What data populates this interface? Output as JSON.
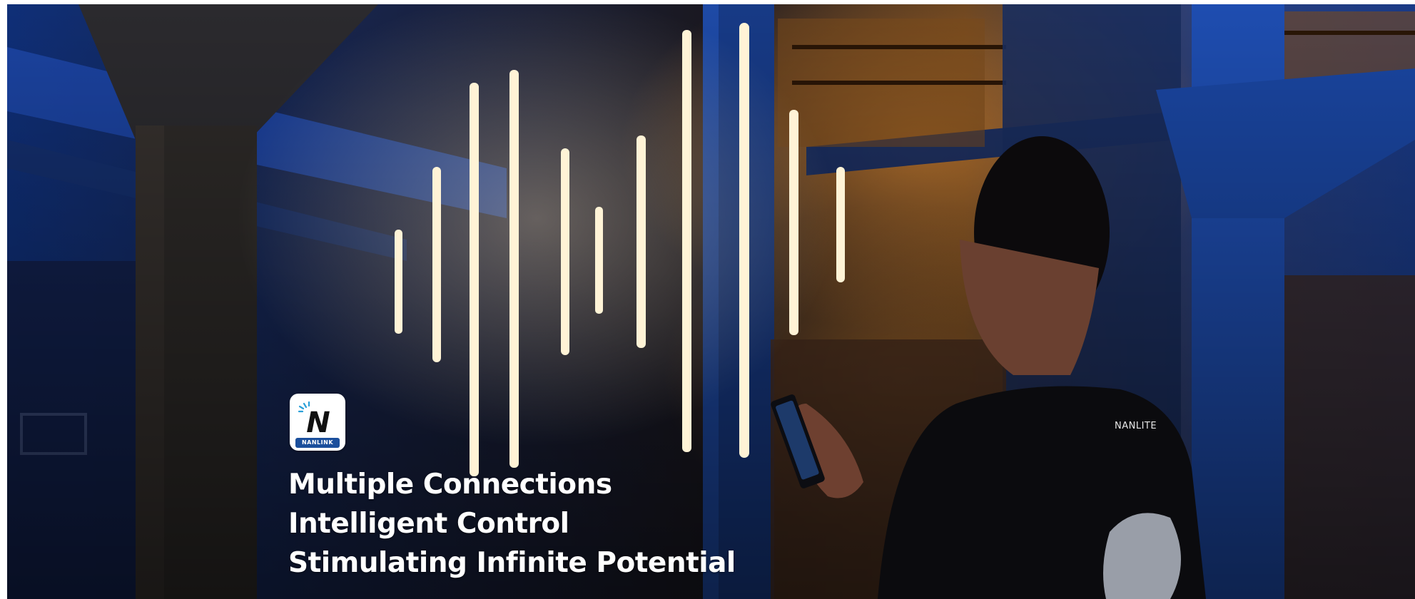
{
  "app_icon": {
    "icon": "nanlink-app-icon",
    "letter": "N",
    "brand": "NANLINK",
    "brand_color": "#1b4f9c"
  },
  "tagline": [
    "Multiple Connections",
    "Intelligent Control",
    "Stimulating Infinite Potential"
  ],
  "shirt_logo": "NANLITE",
  "colors": {
    "tube_glow": "#fff3d6",
    "ambient_blue": "#1f4fa8",
    "ambient_orange": "#b8702a"
  }
}
